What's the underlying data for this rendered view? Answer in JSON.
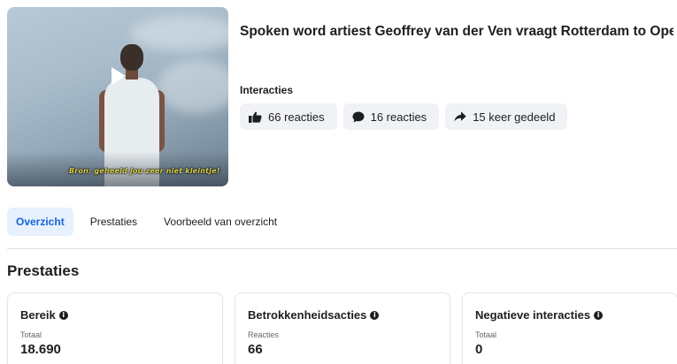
{
  "post": {
    "title": "Spoken word artiest Geoffrey van der Ven vraagt Rotterdam to Ope...",
    "video_subtitle": "Bron: geheeld jou zeer niet kleintje!",
    "interactions_label": "Interacties",
    "chips": [
      {
        "icon": "thumbs-up-icon",
        "label": "66 reacties"
      },
      {
        "icon": "comment-icon",
        "label": "16 reacties"
      },
      {
        "icon": "share-icon",
        "label": "15 keer gedeeld"
      }
    ]
  },
  "tabs": [
    {
      "label": "Overzicht",
      "active": true
    },
    {
      "label": "Prestaties",
      "active": false
    },
    {
      "label": "Voorbeeld van overzicht",
      "active": false
    }
  ],
  "section": {
    "title": "Prestaties"
  },
  "cards": [
    {
      "title": "Bereik",
      "sub": "Totaal",
      "value": "18.690"
    },
    {
      "title": "Betrokkenheidsacties",
      "sub": "Reacties",
      "value": "66"
    },
    {
      "title": "Negatieve interacties",
      "sub": "Totaal",
      "value": "0"
    }
  ],
  "colors": {
    "accent": "#1565d8",
    "tab_active_bg": "#e7f0fd",
    "chip_bg": "#f0f2f5"
  }
}
